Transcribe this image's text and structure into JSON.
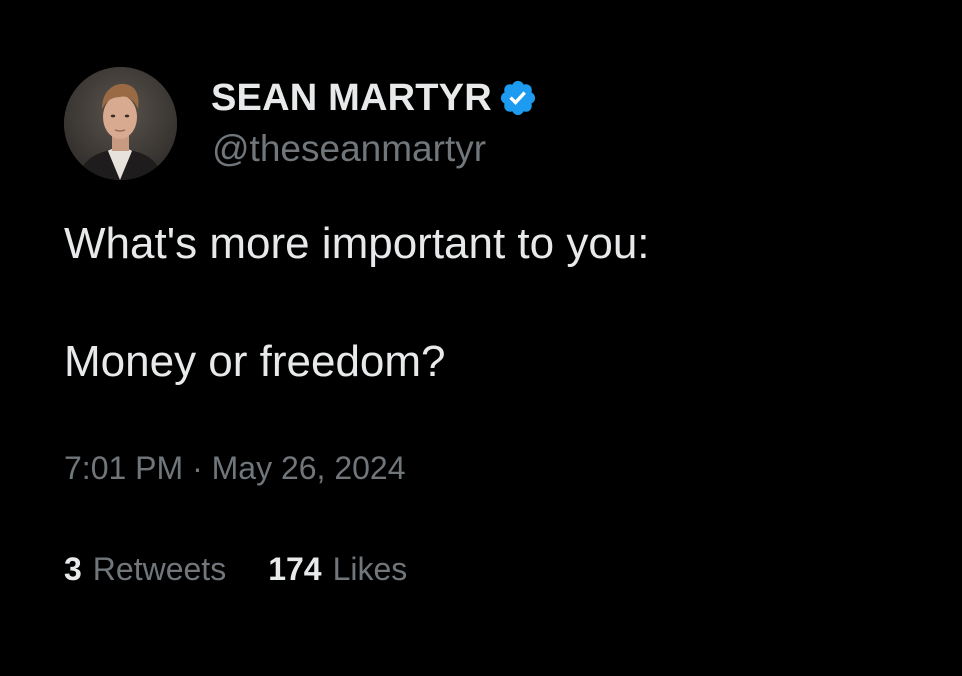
{
  "author": {
    "display_name": "SEAN MARTYR",
    "handle": "@theseanmartyr",
    "verified": true,
    "verified_color": "#1d9bf0",
    "avatar_icon": "profile-photo"
  },
  "tweet": {
    "line1": "What's more important to you:",
    "line2": "Money or freedom?",
    "time": "7:01 PM",
    "separator": "·",
    "date": "May 26, 2024"
  },
  "stats": {
    "retweets_count": "3",
    "retweets_label": "Retweets",
    "likes_count": "174",
    "likes_label": "Likes"
  },
  "colors": {
    "background": "#000000",
    "primary_text": "#e7e9ea",
    "secondary_text": "#71767b"
  }
}
